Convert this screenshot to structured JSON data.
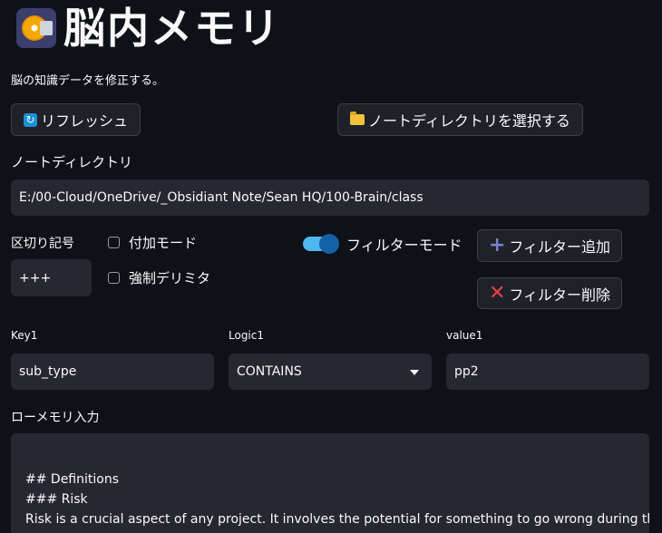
{
  "title": "脳内メモリ",
  "subtitle": "脳の知識データを修正する。",
  "buttons": {
    "refresh": "リフレッシュ",
    "select_dir": "ノートディレクトリを選択する",
    "add_filter": "フィルター追加",
    "remove_filter": "フィルター削除"
  },
  "note_dir": {
    "label": "ノートディレクトリ",
    "value": "E:/00-Cloud/OneDrive/_Obsidiant Note/Sean HQ/100-Brain/class"
  },
  "delimiter": {
    "label": "区切り記号",
    "value": "+++"
  },
  "checkboxes": {
    "append_mode": {
      "label": "付加モード",
      "checked": false
    },
    "force_delimiter": {
      "label": "強制デリミタ",
      "checked": false
    }
  },
  "filter_mode": {
    "label": "フィルターモード",
    "on": true
  },
  "filter_row": {
    "key_label": "Key1",
    "key_value": "sub_type",
    "logic_label": "Logic1",
    "logic_value": "CONTAINS",
    "value_label": "value1",
    "value_value": "pp2"
  },
  "raw_memory": {
    "label": "ローメモリ入力",
    "lines": [
      "## Definitions",
      "### Risk",
      "Risk is a crucial aspect of any project. It involves the potential for something to go wrong during the"
    ]
  },
  "icons": {
    "title": "minidisc-icon",
    "refresh": "refresh-icon",
    "folder": "folder-icon",
    "plus": "plus-icon",
    "close": "x-icon"
  },
  "colors": {
    "background": "#0e1117",
    "input_bg": "#262730",
    "toggle_accent": "#4fb6f0",
    "remove_icon": "#e8414a",
    "add_icon": "#7b7ec8"
  }
}
